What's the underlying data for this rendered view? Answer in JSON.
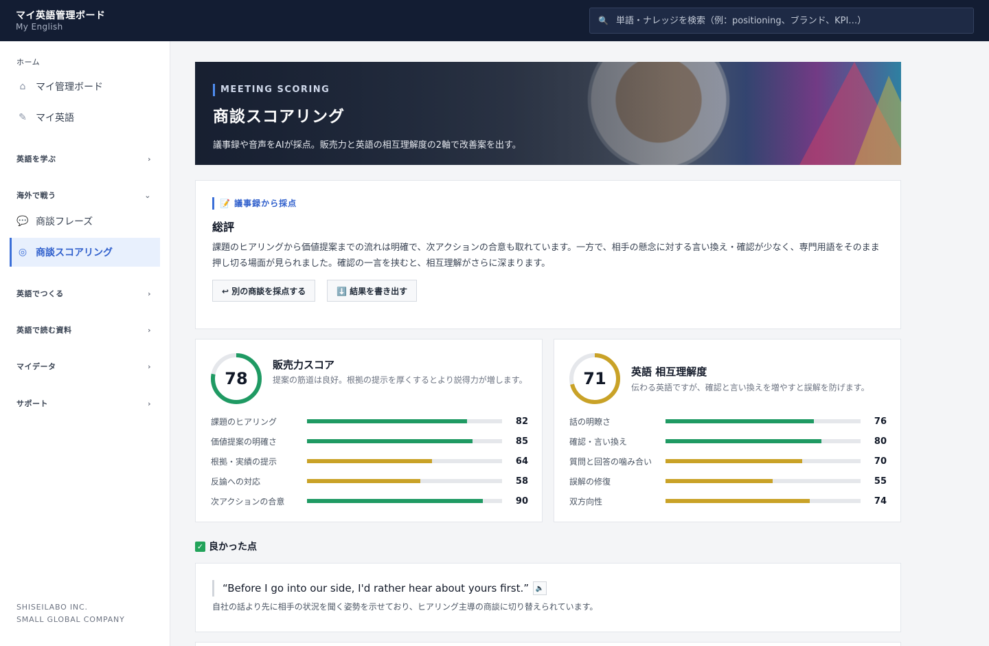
{
  "header": {
    "brand_title": "マイ英語管理ボード",
    "brand_sub": "My English",
    "search_placeholder": "単語・ナレッジを検索（例：positioning、ブランド、KPI…）"
  },
  "sidebar": {
    "home_label": "ホーム",
    "items_home": [
      {
        "label": "マイ管理ボード",
        "icon": "home-icon"
      },
      {
        "label": "マイ英語",
        "icon": "pencil-icon"
      }
    ],
    "learn_label": "英語を学ぶ",
    "fight_label": "海外で戦う",
    "items_fight": [
      {
        "label": "商談フレーズ",
        "icon": "chat-bubble-icon"
      },
      {
        "label": "商談スコアリング",
        "icon": "target-icon"
      }
    ],
    "make_label": "英語でつくる",
    "read_label": "英語で読む資料",
    "data_label": "マイデータ",
    "support_label": "サポート",
    "company_line1": "SHISEILABO INC.",
    "company_line2": "SMALL GLOBAL COMPANY"
  },
  "hero": {
    "tag": "MEETING SCORING",
    "title": "商談スコアリング",
    "desc": "議事録や音声をAIが採点。販売力と英語の相互理解度の2軸で改善案を出す。"
  },
  "summary": {
    "tag": "📝 議事録から採点",
    "title": "総評",
    "text": "課題のヒアリングから価値提案までの流れは明確で、次アクションの合意も取れています。一方で、相手の懸念に対する言い換え・確認が少なく、専門用語をそのまま押し切る場面が見られました。確認の一言を挟むと、相互理解がさらに深まります。",
    "btn_rescore": "↩ 別の商談を採点する",
    "btn_export": "⬇️ 結果を書き出す"
  },
  "sales": {
    "score": 78,
    "title": "販売力スコア",
    "desc": "提案の筋道は良好。根拠の提示を厚くするとより説得力が増します。",
    "ring_color": "#1f9a63",
    "metrics": [
      {
        "label": "課題のヒアリング",
        "value": 82,
        "color": "#1f9a63"
      },
      {
        "label": "価値提案の明確さ",
        "value": 85,
        "color": "#1f9a63"
      },
      {
        "label": "根拠・実績の提示",
        "value": 64,
        "color": "#c9a227"
      },
      {
        "label": "反論への対応",
        "value": 58,
        "color": "#c9a227"
      },
      {
        "label": "次アクションの合意",
        "value": 90,
        "color": "#1f9a63"
      }
    ]
  },
  "english": {
    "score": 71,
    "title": "英語 相互理解度",
    "desc": "伝わる英語ですが、確認と言い換えを増やすと誤解を防げます。",
    "ring_color": "#c9a227",
    "metrics": [
      {
        "label": "話の明瞭さ",
        "value": 76,
        "color": "#1f9a63"
      },
      {
        "label": "確認・言い換え",
        "value": 80,
        "color": "#1f9a63"
      },
      {
        "label": "質問と回答の噛み合い",
        "value": 70,
        "color": "#c9a227"
      },
      {
        "label": "誤解の修復",
        "value": 55,
        "color": "#c9a227"
      },
      {
        "label": "双方向性",
        "value": 74,
        "color": "#c9a227"
      }
    ]
  },
  "good": {
    "heading": "良かった点",
    "quote": "“Before I go into our side, I'd rather hear about yours first.”",
    "note": "自社の話より先に相手の状況を聞く姿勢を示せており、ヒアリング主導の商談に切り替えられています。"
  }
}
